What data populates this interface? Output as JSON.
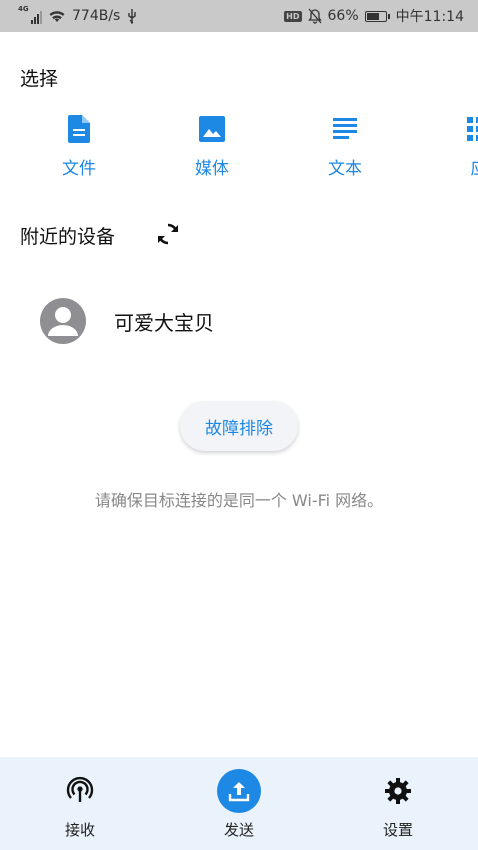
{
  "status_bar": {
    "network_type": "4G",
    "speed": "774B/s",
    "battery": "66%",
    "time": "中午11:14",
    "hd_badge": "HD"
  },
  "select_section": {
    "title": "选择",
    "items": [
      {
        "label": "文件",
        "icon": "file-icon"
      },
      {
        "label": "媒体",
        "icon": "image-icon"
      },
      {
        "label": "文本",
        "icon": "text-icon"
      },
      {
        "label": "应",
        "icon": "apps-icon"
      }
    ]
  },
  "devices_section": {
    "title": "附近的设备",
    "refresh_icon": "refresh-icon",
    "devices": [
      {
        "name": "可爱大宝贝",
        "icon": "person-icon"
      }
    ]
  },
  "troubleshoot_button": "故障排除",
  "hint_text": "请确保目标连接的是同一个 Wi-Fi 网络。",
  "bottom_nav": {
    "items": [
      {
        "label": "接收",
        "icon": "receive-icon",
        "active": false
      },
      {
        "label": "发送",
        "icon": "upload-icon",
        "active": true
      },
      {
        "label": "设置",
        "icon": "gear-icon",
        "active": false
      }
    ]
  },
  "colors": {
    "accent": "#1e88e5",
    "status_bar_bg": "#c9c9c9",
    "bottom_nav_bg": "#eaf3fb",
    "avatar_bg": "#8e8e93"
  }
}
